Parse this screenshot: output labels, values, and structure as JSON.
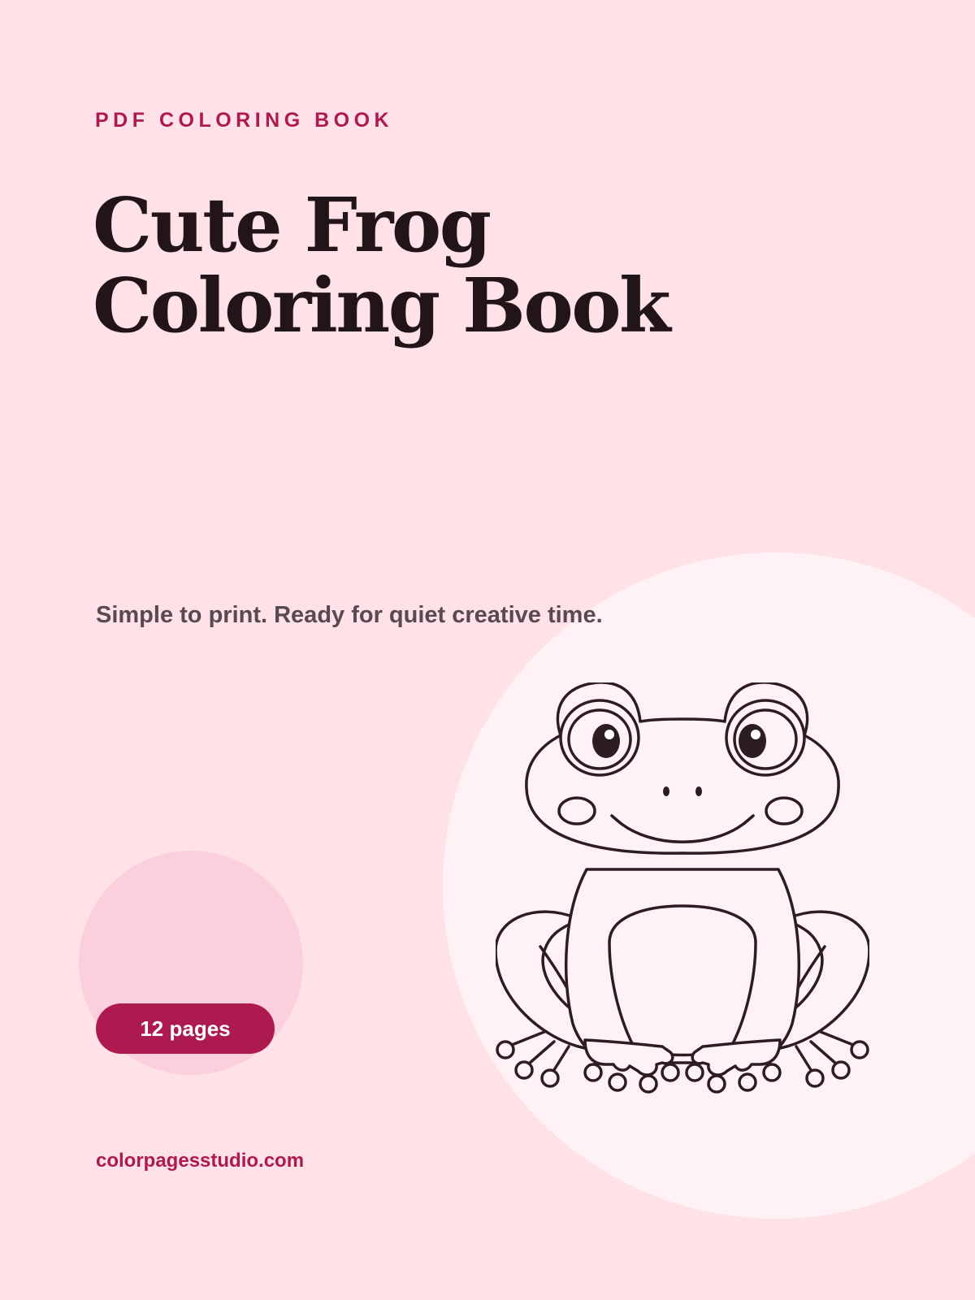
{
  "cover": {
    "kicker": "PDF COLORING BOOK",
    "title_line1": "Cute Frog",
    "title_line2": "Coloring Book",
    "subtitle": "Simple to print. Ready for quiet creative time.",
    "pages_badge": "12 pages",
    "website": "colorpagesstudio.com"
  },
  "illustration": {
    "icon": "frog-illustration-icon"
  },
  "colors": {
    "background": "#ffe1e8",
    "accent": "#ad1a4f",
    "title": "#221519",
    "subtitle": "#594951",
    "circle_light": "#fff2f5",
    "circle_pink": "#fccfdc"
  }
}
